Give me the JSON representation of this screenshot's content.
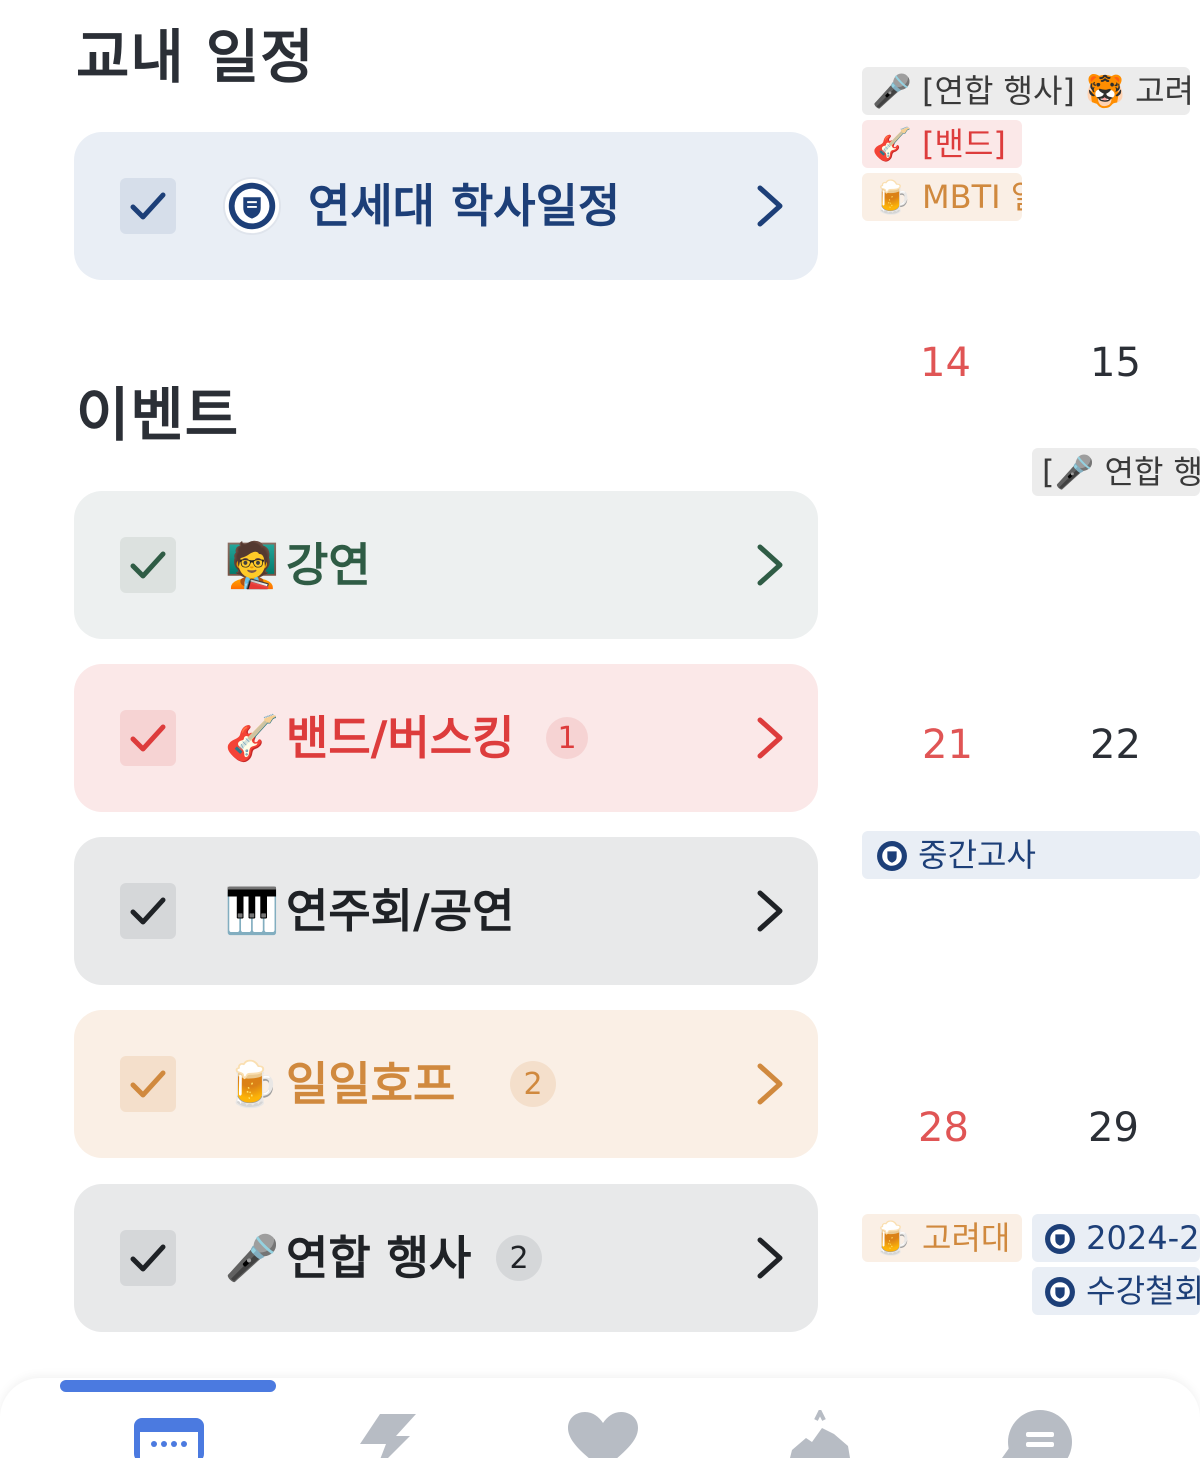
{
  "school_section": {
    "title": "교내 일정",
    "item": {
      "label": "연세대 학사일정"
    }
  },
  "events_section": {
    "title": "이벤트",
    "items": [
      {
        "label": "강연",
        "emoji": "🧑‍🏫",
        "count": ""
      },
      {
        "label": "밴드/버스킹",
        "emoji": "🎸",
        "count": "1"
      },
      {
        "label": "연주회/공연",
        "emoji": "🎹",
        "count": ""
      },
      {
        "label": "일일호프",
        "emoji": "🍺",
        "count": "2"
      },
      {
        "label": "연합 행사",
        "emoji": "🎤",
        "count": "2"
      }
    ]
  },
  "calendar": {
    "chips_top": [
      {
        "emoji": "🎤",
        "text": "[연합 행사] 🐯 고려"
      },
      {
        "emoji": "🎸",
        "text": "[밴드] 🔥"
      },
      {
        "emoji": "🍺",
        "text": "MBTI 일"
      }
    ],
    "days": [
      "14",
      "15",
      "21",
      "22",
      "28",
      "29"
    ],
    "chip_15": {
      "text": "[🎤 연합 행"
    },
    "chip_21": {
      "text": "중간고사"
    },
    "chip_28": {
      "emoji": "🍺",
      "text": "고려대 "
    },
    "chip_29a": {
      "text": "2024-2"
    },
    "chip_29b": {
      "text": "수강철회"
    }
  },
  "colors": {
    "school_bg": "#e9eef5",
    "school_fg": "#1d3f78",
    "lecture_bg": "#edf0f0",
    "lecture_fg": "#2f5c45",
    "band_bg": "#fbe8e8",
    "band_fg": "#dd3c3c",
    "concert_bg": "#e8e9ea",
    "concert_fg": "#1f2226",
    "hof_bg": "#faefe5",
    "hof_fg": "#d0893e",
    "union_bg": "#e8e9ea",
    "union_fg": "#1f2226",
    "sunday": "#e05555",
    "accent": "#4b7ae0"
  },
  "nav": {
    "items": [
      "calendar-icon",
      "bolt-icon",
      "heart-icon",
      "map-icon",
      "chat-icon"
    ]
  }
}
